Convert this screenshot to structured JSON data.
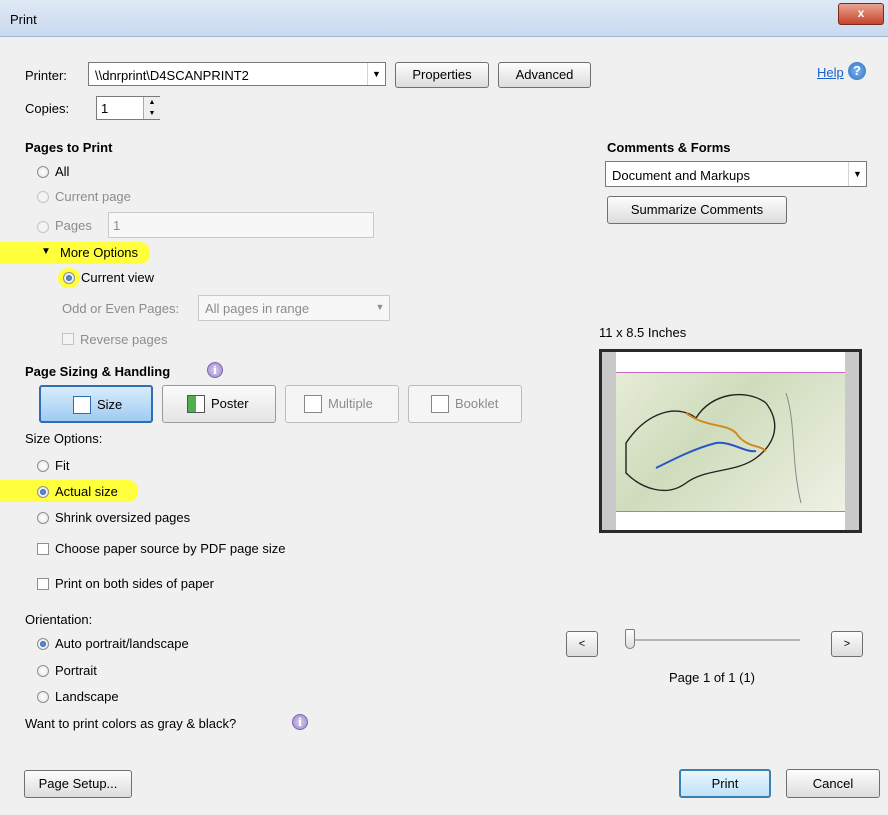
{
  "window": {
    "title": "Print",
    "close_label": "x"
  },
  "header": {
    "printer_label": "Printer:",
    "printer_value": "\\\\dnrprint\\D4SCANPRINT2",
    "properties_label": "Properties",
    "advanced_label": "Advanced",
    "help_label": "Help",
    "copies_label": "Copies:",
    "copies_value": "1"
  },
  "pages_to_print": {
    "heading": "Pages to Print",
    "all_label": "All",
    "current_page_label": "Current page",
    "pages_label": "Pages",
    "pages_value": "1",
    "more_options_label": "More Options",
    "current_view_label": "Current view",
    "odd_even_label": "Odd or Even Pages:",
    "odd_even_value": "All pages in range",
    "reverse_label": "Reverse pages",
    "selected": "current_view"
  },
  "sizing": {
    "heading": "Page Sizing & Handling",
    "buttons": [
      "Size",
      "Poster",
      "Multiple",
      "Booklet"
    ],
    "active": "Size",
    "size_options_label": "Size Options:",
    "fit_label": "Fit",
    "actual_size_label": "Actual size",
    "shrink_label": "Shrink oversized pages",
    "selected": "actual_size",
    "paper_source_label": "Choose paper source by PDF page size",
    "both_sides_label": "Print on both sides of paper"
  },
  "orientation": {
    "heading": "Orientation:",
    "auto_label": "Auto portrait/landscape",
    "portrait_label": "Portrait",
    "landscape_label": "Landscape",
    "selected": "auto",
    "gray_label": "Want to print colors as gray & black?"
  },
  "comments_forms": {
    "heading": "Comments & Forms",
    "value": "Document and Markups",
    "summarize_label": "Summarize Comments"
  },
  "preview": {
    "size_label": "11 x 8.5 Inches",
    "prev_label": "<",
    "next_label": ">",
    "page_label": "Page 1 of 1 (1)",
    "slider_position": 0
  },
  "footer": {
    "page_setup_label": "Page Setup...",
    "print_label": "Print",
    "cancel_label": "Cancel"
  },
  "colors": {
    "highlight": "#ffff3c",
    "active_button": "#9fcbf1",
    "link": "#1a5fd0"
  }
}
